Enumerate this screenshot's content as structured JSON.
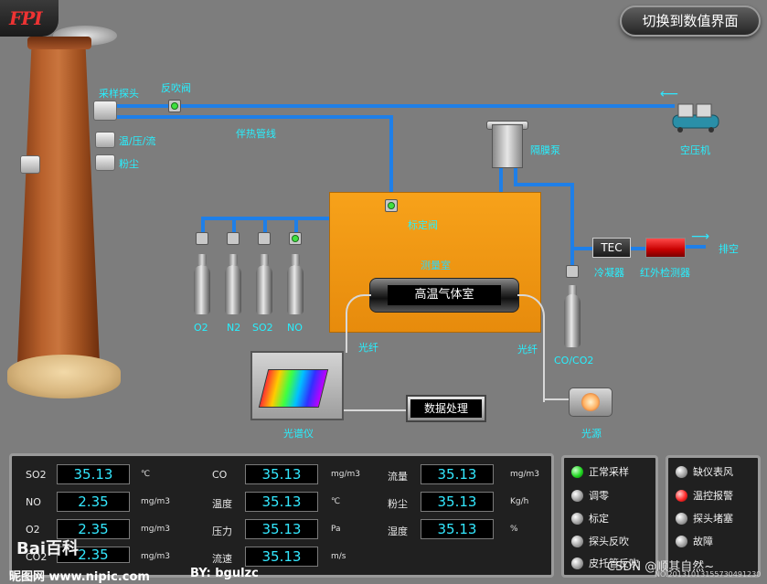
{
  "logo": {
    "text": "FPI"
  },
  "switch_button": {
    "label": "切换到数值界面"
  },
  "labels": {
    "sampling_probe": "采样探头",
    "backflush_valve": "反吹阀",
    "temp_pressure_flow": "温/压/流",
    "dust": "粉尘",
    "heat_trace_line": "伴热管线",
    "diaphragm_pump": "隔膜泵",
    "air_compressor": "空压机",
    "calibration_valve": "标定阀",
    "measurement_room": "测量室",
    "hot_gas_cell": "高温气体室",
    "optical_fiber_left": "光纤",
    "optical_fiber_right": "光纤",
    "spectrometer": "光谱仪",
    "data_processing": "数据处理",
    "light_source": "光源",
    "tec": "TEC",
    "cooler": "冷凝器",
    "ir_detector": "红外检测器",
    "exhaust": "排空",
    "co_co2": "CO/CO2"
  },
  "gas_cylinders": [
    "O2",
    "N2",
    "SO2",
    "NO"
  ],
  "readings": [
    {
      "label": "SO2",
      "value": "35.13",
      "unit": "℃"
    },
    {
      "label": "NO",
      "value": "2.35",
      "unit": "mg/m3"
    },
    {
      "label": "O2",
      "value": "2.35",
      "unit": "mg/m3"
    },
    {
      "label": "CO2",
      "value": "2.35",
      "unit": "mg/m3"
    },
    {
      "label": "CO",
      "value": "35.13",
      "unit": "mg/m3"
    },
    {
      "label": "温度",
      "value": "35.13",
      "unit": "℃"
    },
    {
      "label": "压力",
      "value": "35.13",
      "unit": "Pa"
    },
    {
      "label": "流速",
      "value": "35.13",
      "unit": "m/s"
    },
    {
      "label": "流量",
      "value": "35.13",
      "unit": "mg/m3"
    },
    {
      "label": "粉尘",
      "value": "35.13",
      "unit": "Kg/h"
    },
    {
      "label": "湿度",
      "value": "35.13",
      "unit": "%"
    }
  ],
  "status_left": [
    {
      "label": "正常采样",
      "state": "green"
    },
    {
      "label": "调零",
      "state": "gray"
    },
    {
      "label": "标定",
      "state": "gray"
    },
    {
      "label": "探头反吹",
      "state": "gray"
    },
    {
      "label": "皮托管反吹",
      "state": "gray"
    }
  ],
  "status_right": [
    {
      "label": "缺仪表风",
      "state": "gray"
    },
    {
      "label": "温控报警",
      "state": "red"
    },
    {
      "label": "探头堵塞",
      "state": "gray"
    },
    {
      "label": "故障",
      "state": "gray"
    }
  ],
  "watermarks": {
    "baidu": "Bai百科",
    "nipic": "昵图网 www.nipic.com",
    "author": "BY: bgulzc",
    "csdn": "CSDN @顺其自然~",
    "number": "NO.20131013155730491230"
  },
  "colors": {
    "pipe": "#1e7fe8",
    "label_cyan": "#27f0ff",
    "chamber_orange": "#f39a14",
    "reading_text": "#33e8ff"
  }
}
